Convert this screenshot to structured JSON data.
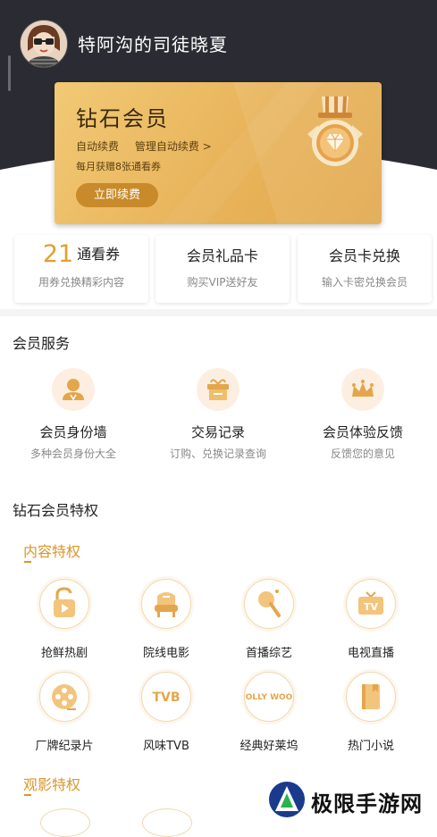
{
  "header": {
    "username": "特阿沟的司徒晓夏"
  },
  "vip_card": {
    "title": "钻石会员",
    "auto_renew": "自动续费",
    "manage_renew": "管理自动续费 >",
    "monthly_gift": "每月获赠8张通看券",
    "renew_button": "立即续费"
  },
  "quick_cards": [
    {
      "count": "21",
      "title": "通看券",
      "subtitle": "用券兑换精彩内容"
    },
    {
      "title": "会员礼品卡",
      "subtitle": "购买VIP送好友"
    },
    {
      "title": "会员卡兑换",
      "subtitle": "输入卡密兑换会员"
    }
  ],
  "services": {
    "title": "会员服务",
    "items": [
      {
        "label": "会员身份墙",
        "subtitle": "多种会员身份大全",
        "icon": "member-avatar-icon"
      },
      {
        "label": "交易记录",
        "subtitle": "订购、兑换记录查询",
        "icon": "gift-box-icon"
      },
      {
        "label": "会员体验反馈",
        "subtitle": "反馈您的意见",
        "icon": "crown-icon"
      }
    ]
  },
  "privileges": {
    "title": "钻石会员特权",
    "content_head": "内容特权",
    "items": [
      {
        "label": "抢鲜热剧",
        "icon": "unlock-play-icon"
      },
      {
        "label": "院线电影",
        "icon": "cinema-seat-icon"
      },
      {
        "label": "首播综艺",
        "icon": "microphone-icon"
      },
      {
        "label": "电视直播",
        "icon": "tv-icon"
      },
      {
        "label": "厂牌纪录片",
        "icon": "film-reel-icon"
      },
      {
        "label": "风味TVB",
        "icon": "tvb-logo-icon"
      },
      {
        "label": "经典好莱坞",
        "icon": "hollywood-logo-icon"
      },
      {
        "label": "热门小说",
        "icon": "book-icon"
      }
    ],
    "viewing_head": "观影特权",
    "tvb_text": "TVB",
    "hollywood_text": "HOLLY WOOD"
  },
  "watermark": {
    "text": "极限手游网"
  },
  "colors": {
    "dark_bg": "#2b2b33",
    "gold": "#e0a030",
    "accent_orange": "#d9962c"
  }
}
